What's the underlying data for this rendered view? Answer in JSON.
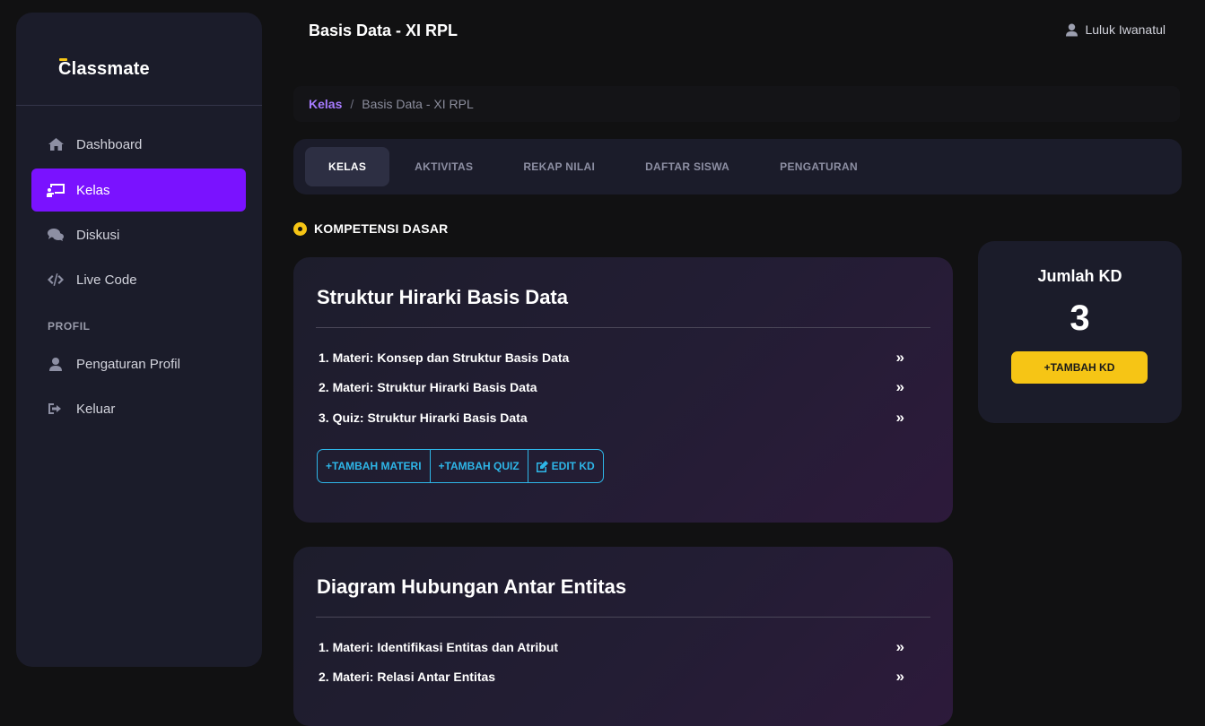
{
  "app": {
    "logo_text": "Classmate"
  },
  "sidebar": {
    "items": [
      {
        "label": "Dashboard",
        "icon": "home-icon"
      },
      {
        "label": "Kelas",
        "icon": "class-board-icon",
        "active": true
      },
      {
        "label": "Diskusi",
        "icon": "chat-bubbles-icon"
      },
      {
        "label": "Live Code",
        "icon": "code-icon"
      }
    ],
    "section_label": "PROFIL",
    "profile_items": [
      {
        "label": "Pengaturan Profil",
        "icon": "user-icon"
      },
      {
        "label": "Keluar",
        "icon": "sign-out-icon"
      }
    ]
  },
  "header": {
    "title": "Basis Data - XI RPL",
    "user_name": "Luluk Iwanatul"
  },
  "breadcrumb": {
    "link": "Kelas",
    "separator": "/",
    "current": "Basis Data - XI RPL"
  },
  "tabs": [
    {
      "label": "KELAS",
      "active": true
    },
    {
      "label": "AKTIVITAS"
    },
    {
      "label": "REKAP NILAI"
    },
    {
      "label": "DAFTAR SISWA"
    },
    {
      "label": "PENGATURAN"
    }
  ],
  "section_title": "KOMPETENSI DASAR",
  "kd_cards": [
    {
      "title": "Struktur Hirarki Basis Data",
      "items": [
        "1. Materi: Konsep dan Struktur Basis Data",
        "2. Materi: Struktur Hirarki Basis Data",
        "3. Quiz: Struktur Hirarki Basis Data"
      ],
      "buttons": {
        "add_materi": "+TAMBAH MATERI",
        "add_quiz": "+TAMBAH QUIZ",
        "edit_kd": "EDIT KD"
      }
    },
    {
      "title": "Diagram Hubungan Antar Entitas",
      "items": [
        "1. Materi: Identifikasi Entitas dan Atribut",
        "2. Materi: Relasi Antar Entitas"
      ]
    }
  ],
  "jumlah_kd": {
    "label": "Jumlah KD",
    "count": "3",
    "button": "+TAMBAH KD"
  },
  "colors": {
    "accent": "#7a12ff",
    "yellow": "#f6c515",
    "cyan": "#2eb6e8",
    "link": "#a77bff"
  }
}
